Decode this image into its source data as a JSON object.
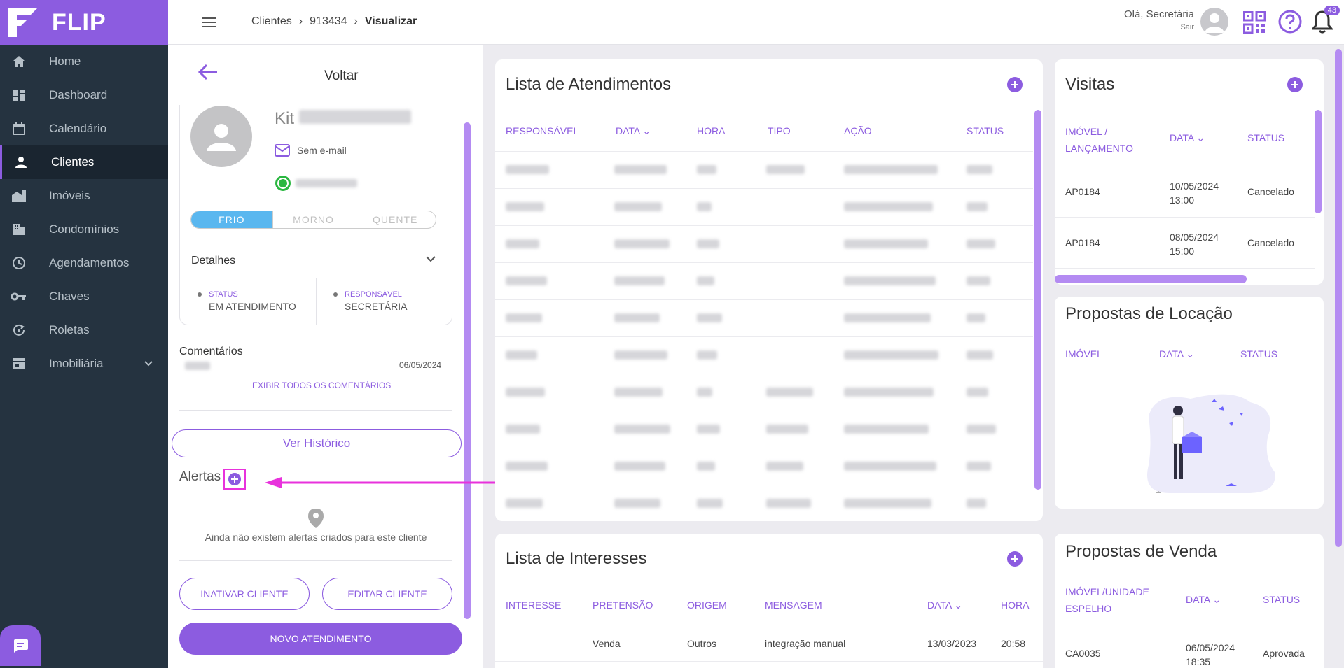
{
  "app": {
    "name": "FLIP"
  },
  "sidebar": {
    "items": [
      {
        "label": "Home",
        "icon": "home-icon"
      },
      {
        "label": "Dashboard",
        "icon": "dashboard-icon"
      },
      {
        "label": "Calendário",
        "icon": "calendar-icon"
      },
      {
        "label": "Clientes",
        "icon": "user-icon",
        "active": true
      },
      {
        "label": "Imóveis",
        "icon": "building-icon"
      },
      {
        "label": "Condomínios",
        "icon": "condo-icon"
      },
      {
        "label": "Agendamentos",
        "icon": "clock-icon"
      },
      {
        "label": "Chaves",
        "icon": "key-icon"
      },
      {
        "label": "Roletas",
        "icon": "roulette-icon"
      },
      {
        "label": "Imobiliária",
        "icon": "store-icon"
      }
    ]
  },
  "header": {
    "breadcrumb": [
      "Clientes",
      "913434",
      "Visualizar"
    ],
    "greeting": "Olá, Secretária",
    "logout": "Sair",
    "notifications": "43"
  },
  "client": {
    "back_label": "Voltar",
    "name": "Kit",
    "email": "Sem e-mail",
    "temperature": [
      "FRIO",
      "MORNO",
      "QUENTE"
    ],
    "details_label": "Detalhes",
    "status_label": "STATUS",
    "status_value": "EM ATENDIMENTO",
    "responsavel_label": "RESPONSÁVEL",
    "responsavel_value": "SECRETÁRIA",
    "comments_label": "Comentários",
    "comment_date": "06/05/2024",
    "show_all_comments": "EXIBIR TODOS OS COMENTÁRIOS",
    "history_button": "Ver Histórico",
    "alerts_label": "Alertas",
    "no_alerts": "Ainda não existem alertas criados para este cliente",
    "inactivate_button": "INATIVAR CLIENTE",
    "edit_button": "EDITAR CLIENTE",
    "new_service_button": "NOVO ATENDIMENTO"
  },
  "atendimentos": {
    "title": "Lista de Atendimentos",
    "columns": [
      "RESPONSÁVEL",
      "DATA",
      "HORA",
      "TIPO",
      "AÇÃO",
      "STATUS"
    ]
  },
  "interesses": {
    "title": "Lista de Interesses",
    "columns": [
      "INTERESSE",
      "PRETENSÃO",
      "ORIGEM",
      "MENSAGEM",
      "DATA",
      "HORA"
    ],
    "rows": [
      {
        "pretensao": "Venda",
        "origem": "Outros",
        "mensagem": "integração manual",
        "data": "13/03/2023",
        "hora": "20:58"
      }
    ]
  },
  "visitas": {
    "title": "Visitas",
    "columns": [
      "IMÓVEL /",
      "LANÇAMENTO",
      "DATA",
      "STATUS"
    ],
    "rows": [
      {
        "imovel": "AP0184",
        "data": "10/05/2024",
        "hora": "13:00",
        "status": "Cancelado"
      },
      {
        "imovel": "AP0184",
        "data": "08/05/2024",
        "hora": "15:00",
        "status": "Cancelado"
      }
    ]
  },
  "locacao": {
    "title": "Propostas de Locação",
    "columns": [
      "IMÓVEL",
      "DATA",
      "STATUS"
    ]
  },
  "venda": {
    "title": "Propostas de Venda",
    "columns": [
      "IMÓVEL/UNIDADE",
      "ESPELHO",
      "DATA",
      "STATUS"
    ],
    "rows": [
      {
        "imovel": "CA0035",
        "data": "06/05/2024",
        "hora": "18:35",
        "status": "Aprovada"
      }
    ]
  },
  "colors": {
    "accent": "#8c5ce0",
    "sidebar": "#253340",
    "highlight": "#e832dc",
    "cold": "#5ab7ef"
  }
}
